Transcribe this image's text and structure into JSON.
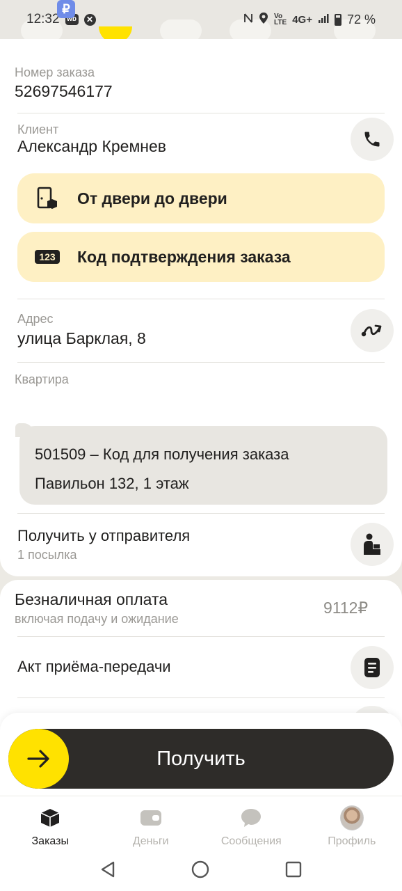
{
  "status_bar": {
    "time": "12:32",
    "badge_wb": "wb",
    "badge_ruble": "₽",
    "network": "4G+",
    "battery": "72 %"
  },
  "order": {
    "number_label": "Номер заказа",
    "number_value": "52697546177"
  },
  "client": {
    "label": "Клиент",
    "name": "Александр Кремнев"
  },
  "pills": {
    "door_to_door": "От двери до двери",
    "confirmation_code": "Код подтверждения заказа",
    "code_icon_text": "123"
  },
  "address": {
    "label": "Адрес",
    "value": "улица Барклая, 8"
  },
  "apartment": {
    "label": "Квартира"
  },
  "comment": {
    "line1": "501509 – Код для получения заказа",
    "line2": "Павильон 132,  1 этаж"
  },
  "pickup": {
    "title": "Получить у отправителя",
    "subtitle": "1 посылка"
  },
  "payment": {
    "title": "Безналичная оплата",
    "subtitle": "включая подачу и ожидание",
    "price": "9112₽"
  },
  "act": {
    "title": "Акт приёма-передачи"
  },
  "action": {
    "label": "Получить"
  },
  "tabs": [
    {
      "label": "Заказы",
      "icon": "box-icon",
      "active": true
    },
    {
      "label": "Деньги",
      "icon": "wallet-icon",
      "active": false
    },
    {
      "label": "Сообщения",
      "icon": "chat-icon",
      "active": false
    },
    {
      "label": "Профиль",
      "icon": "avatar",
      "active": false
    }
  ],
  "colors": {
    "accent_yellow": "#ffe200",
    "pill_bg": "#fef0c4",
    "dark_button": "#2e2c29"
  }
}
